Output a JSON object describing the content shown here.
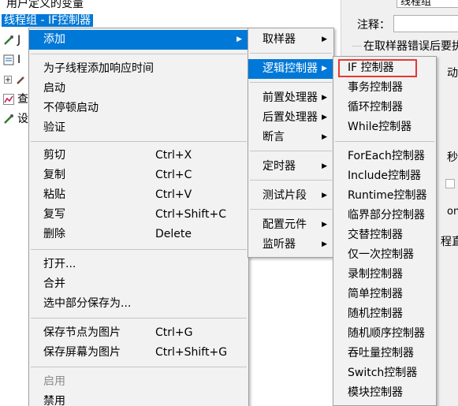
{
  "tree": {
    "nodes": [
      {
        "label": "用户定义的变量"
      },
      {
        "label": "线程组 - IF控制器"
      },
      {
        "label": "J"
      },
      {
        "label": "I"
      },
      {
        "label": ""
      },
      {
        "label": "查"
      },
      {
        "label": "设"
      }
    ]
  },
  "props": {
    "name_value": "线程组",
    "comment_label": "注释：",
    "error_text": "在取样器错误后要执",
    "move_text": "动",
    "seconds_text": "秒",
    "on_text": "on",
    "thread_text": "程直"
  },
  "main_menu": {
    "add": "添加",
    "add_think_time": "为子线程添加响应时间",
    "start": "启动",
    "start_no_pause": "不停顿启动",
    "validate": "验证",
    "cut": "剪切",
    "cut_sc": "Ctrl+X",
    "copy": "复制",
    "copy_sc": "Ctrl+C",
    "paste": "粘贴",
    "paste_sc": "Ctrl+V",
    "duplicate": "复写",
    "duplicate_sc": "Ctrl+Shift+C",
    "delete": "删除",
    "delete_sc": "Delete",
    "open": "打开...",
    "merge": "合并",
    "save_selection": "选中部分保存为...",
    "save_node_img": "保存节点为图片",
    "save_node_img_sc": "Ctrl+G",
    "save_screen_img": "保存屏幕为图片",
    "save_screen_img_sc": "Ctrl+Shift+G",
    "enable": "启用",
    "disable": "禁用"
  },
  "sub_menu": {
    "sampler": "取样器",
    "logic_controller": "逻辑控制器",
    "pre_processor": "前置处理器",
    "post_processor": "后置处理器",
    "assertion": "断言",
    "timer": "定时器",
    "test_fragment": "测试片段",
    "config_element": "配置元件",
    "listener": "监听器"
  },
  "logic_menu": {
    "items": [
      "IF 控制器",
      "事务控制器",
      "循环控制器",
      "While控制器",
      "ForEach控制器",
      "Include控制器",
      "Runtime控制器",
      "临界部分控制器",
      "交替控制器",
      "仅一次控制器",
      "录制控制器",
      "简单控制器",
      "随机控制器",
      "随机顺序控制器",
      "吞吐量控制器",
      "Switch控制器",
      "模块控制器"
    ]
  },
  "colors": {
    "highlight": "#0078d7",
    "focus_box": "#e53935",
    "menu_bg": "#f2f2f2"
  }
}
